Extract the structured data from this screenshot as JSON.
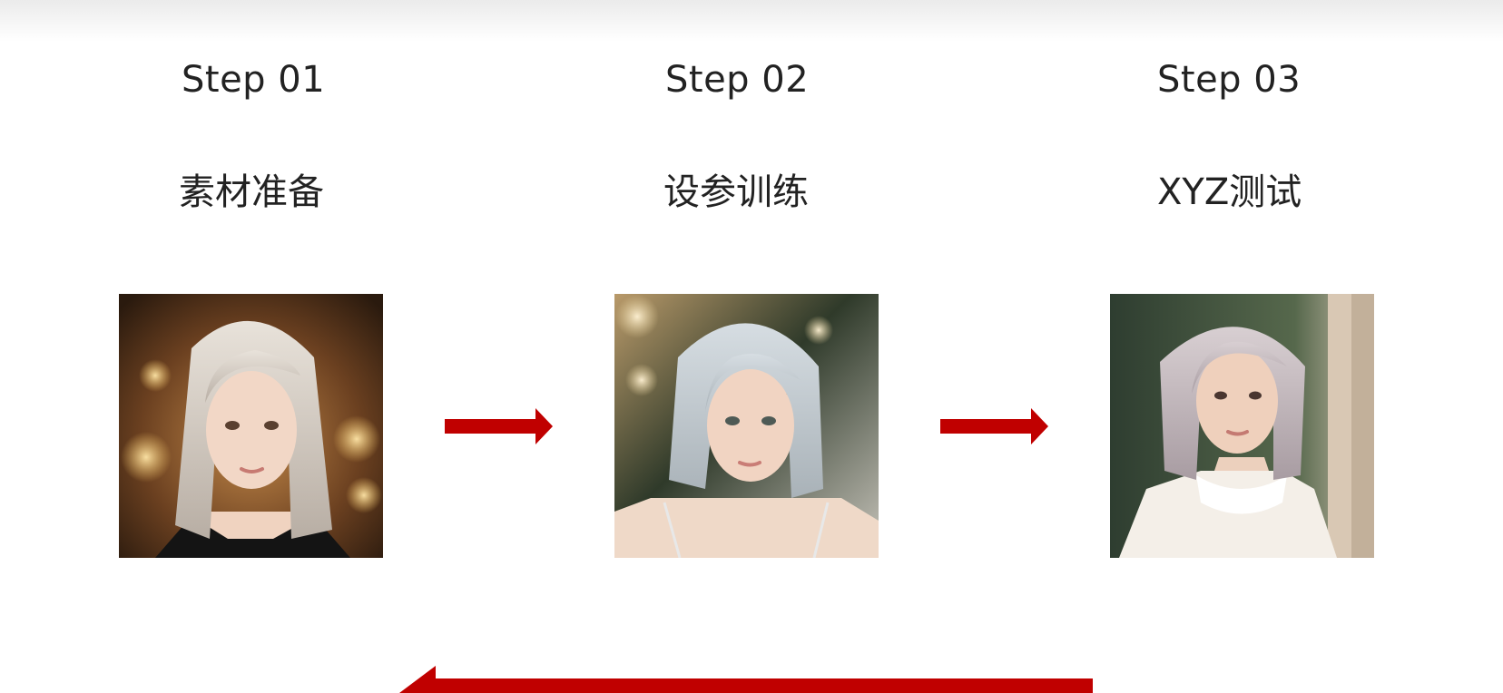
{
  "steps": [
    {
      "number": "Step 01",
      "title": "素材准备",
      "photo": "portrait-photo-silver-bob-warm-bokeh"
    },
    {
      "number": "Step 02",
      "title": "设参训练",
      "photo": "portrait-photo-silver-bob-outdoor"
    },
    {
      "number": "Step 03",
      "title": "XYZ测试",
      "photo": "portrait-photo-silver-bob-white-blouse"
    }
  ],
  "colors": {
    "arrow": "#c00000",
    "text": "#222222"
  }
}
